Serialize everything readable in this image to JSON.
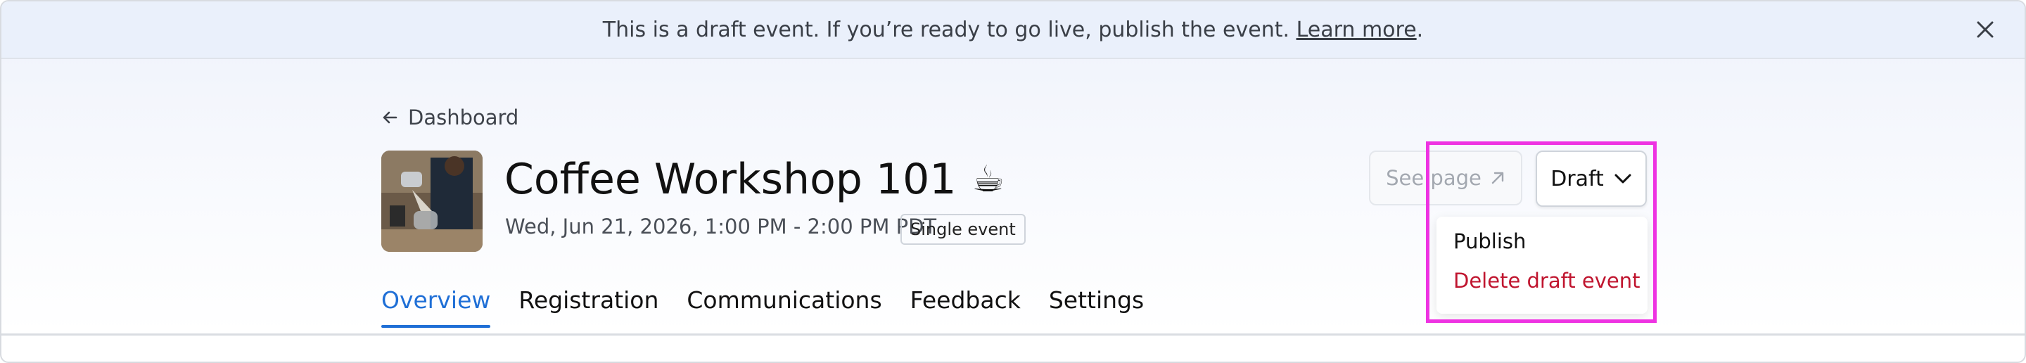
{
  "banner": {
    "message": "This is a draft event. If you’re ready to go live, publish the event.",
    "link": "Learn more",
    "suffix": "."
  },
  "back": {
    "label": "Dashboard"
  },
  "event": {
    "title": "Coffee Workshop 101",
    "emoji": "☕",
    "datetime": "Wed, Jun 21, 2026, 1:00 PM - 2:00 PM PDT",
    "type_badge": "Single event"
  },
  "actions": {
    "see_page": "See page",
    "status_button": "Draft"
  },
  "status_menu": {
    "items": [
      "Publish",
      "Delete draft event"
    ]
  },
  "tabs": [
    "Overview",
    "Registration",
    "Communications",
    "Feedback",
    "Settings"
  ],
  "colors": {
    "accent": "#1f6fd6",
    "danger": "#c0152f",
    "highlight": "#ee33e2"
  }
}
